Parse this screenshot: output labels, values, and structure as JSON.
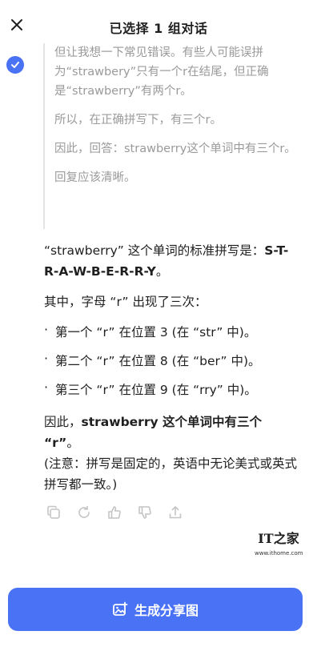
{
  "header": {
    "title": "已选择 1 组对话"
  },
  "thought": {
    "p1": "但让我想一下常见错误。有些人可能误拼为“strawbery”只有一个r在结尾，但正确是“strawberry”有两个r。",
    "p2": "所以，在正确拼写下，有三个r。",
    "p3": "因此，回答：strawberry这个单词中有三个r。",
    "p4": "回复应该清晰。"
  },
  "answer": {
    "spelling_intro": "“strawberry” 这个单词的标准拼写是：",
    "spelling_value": "S-T-R-A-W-B-E-R-R-Y",
    "spelling_end": "。",
    "count_intro": "其中，字母 “r” 出现了三次：",
    "bullets": [
      "第一个 “r” 在位置 3 (在 “str” 中)。",
      "第二个 “r” 在位置 8 (在 “ber” 中)。",
      "第三个 “r” 在位置 9 (在 “rry” 中)。"
    ],
    "bullet_marker": "·",
    "conclusion_prefix": "因此，",
    "conclusion_bold": "strawberry 这个单词中有三个 “r”",
    "conclusion_end": "。",
    "note": "(注意：拼写是固定的，英语中无论美式或英式拼写都一致。)"
  },
  "actions": [
    "copy-icon",
    "regenerate-icon",
    "thumbs-up-icon",
    "thumbs-down-icon",
    "share-icon"
  ],
  "watermark": {
    "logo": "IT之家",
    "url": "www.ithome.com"
  },
  "share_button": {
    "label": "生成分享图",
    "color": "#4a72f5"
  }
}
